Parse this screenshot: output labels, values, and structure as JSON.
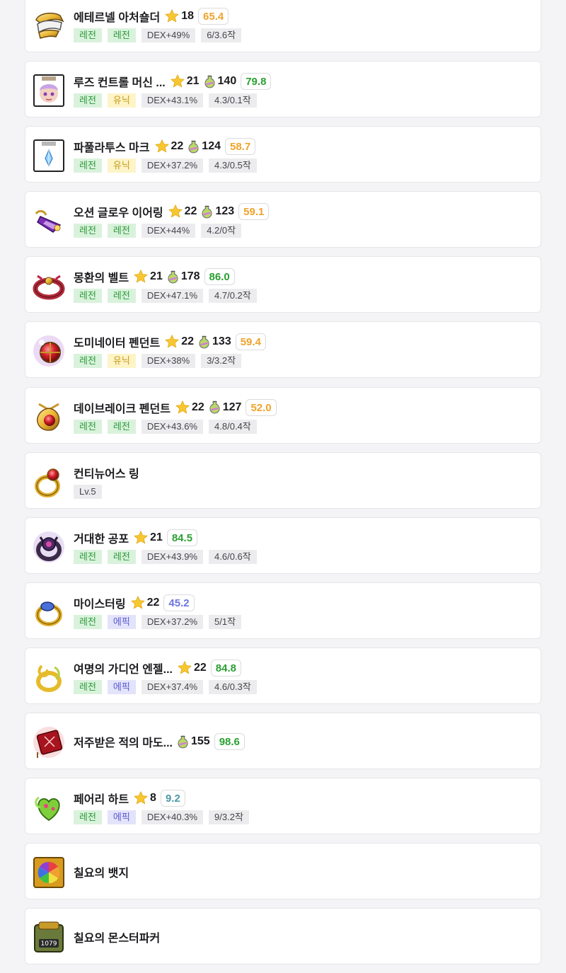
{
  "colors": {
    "score_green": "#2aa033",
    "score_orange": "#f0a32b",
    "score_blue": "#6c74e2",
    "score_teal": "#4b9aa8",
    "legendary_tag": "#d9f2dc",
    "unique_tag": "#fdf4c7",
    "epic_tag": "#e3e3fb"
  },
  "items": [
    {
      "name": "에테르넬 아처숄더",
      "icon": "archer-shoulder-icon",
      "stars": "18",
      "score": "65.4",
      "score_color": "#f0a32b",
      "tags": [
        {
          "text": "레전",
          "kind": "leg"
        },
        {
          "text": "레전",
          "kind": "leg"
        },
        {
          "text": "DEX+49%",
          "kind": "plain"
        },
        {
          "text": "6/3.6작",
          "kind": "plain"
        }
      ]
    },
    {
      "name": "루즈 컨트롤 머신 ...",
      "icon": "machine-card-icon",
      "stars": "21",
      "potential": "140",
      "score": "79.8",
      "score_color": "#2aa033",
      "tags": [
        {
          "text": "레전",
          "kind": "leg"
        },
        {
          "text": "유닉",
          "kind": "uni"
        },
        {
          "text": "DEX+43.1%",
          "kind": "plain"
        },
        {
          "text": "4.3/0.1작",
          "kind": "plain"
        }
      ]
    },
    {
      "name": "파풀라투스 마크",
      "icon": "papulatus-mark-icon",
      "stars": "22",
      "potential": "124",
      "score": "58.7",
      "score_color": "#f0a32b",
      "tags": [
        {
          "text": "레전",
          "kind": "leg"
        },
        {
          "text": "유닉",
          "kind": "uni"
        },
        {
          "text": "DEX+37.2%",
          "kind": "plain"
        },
        {
          "text": "4.3/0.5작",
          "kind": "plain"
        }
      ]
    },
    {
      "name": "오션 글로우 이어링",
      "icon": "earring-icon",
      "stars": "22",
      "potential": "123",
      "score": "59.1",
      "score_color": "#f0a32b",
      "tags": [
        {
          "text": "레전",
          "kind": "leg"
        },
        {
          "text": "레전",
          "kind": "leg"
        },
        {
          "text": "DEX+44%",
          "kind": "plain"
        },
        {
          "text": "4.2/0작",
          "kind": "plain"
        }
      ]
    },
    {
      "name": "몽환의 벨트",
      "icon": "belt-icon",
      "stars": "21",
      "potential": "178",
      "score": "86.0",
      "score_color": "#2aa033",
      "tags": [
        {
          "text": "레전",
          "kind": "leg"
        },
        {
          "text": "레전",
          "kind": "leg"
        },
        {
          "text": "DEX+47.1%",
          "kind": "plain"
        },
        {
          "text": "4.7/0.2작",
          "kind": "plain"
        }
      ]
    },
    {
      "name": "도미네이터 펜던트",
      "icon": "dominator-pendant-icon",
      "stars": "22",
      "potential": "133",
      "score": "59.4",
      "score_color": "#f0a32b",
      "tags": [
        {
          "text": "레전",
          "kind": "leg"
        },
        {
          "text": "유닉",
          "kind": "uni"
        },
        {
          "text": "DEX+38%",
          "kind": "plain"
        },
        {
          "text": "3/3.2작",
          "kind": "plain"
        }
      ]
    },
    {
      "name": "데이브레이크 펜던트",
      "icon": "daybreak-pendant-icon",
      "stars": "22",
      "potential": "127",
      "score": "52.0",
      "score_color": "#f0a32b",
      "tags": [
        {
          "text": "레전",
          "kind": "leg"
        },
        {
          "text": "레전",
          "kind": "leg"
        },
        {
          "text": "DEX+43.6%",
          "kind": "plain"
        },
        {
          "text": "4.8/0.4작",
          "kind": "plain"
        }
      ]
    },
    {
      "name": "컨티뉴어스 링",
      "icon": "continuous-ring-icon",
      "tags": [
        {
          "text": "Lv.5",
          "kind": "plain"
        }
      ]
    },
    {
      "name": "거대한 공포",
      "icon": "great-fear-ring-icon",
      "stars": "21",
      "score": "84.5",
      "score_color": "#2aa033",
      "tags": [
        {
          "text": "레전",
          "kind": "leg"
        },
        {
          "text": "레전",
          "kind": "leg"
        },
        {
          "text": "DEX+43.9%",
          "kind": "plain"
        },
        {
          "text": "4.6/0.6작",
          "kind": "plain"
        }
      ]
    },
    {
      "name": "마이스터링",
      "icon": "meister-ring-icon",
      "stars": "22",
      "score": "45.2",
      "score_color": "#6c74e2",
      "tags": [
        {
          "text": "레전",
          "kind": "leg"
        },
        {
          "text": "에픽",
          "kind": "epi"
        },
        {
          "text": "DEX+37.2%",
          "kind": "plain"
        },
        {
          "text": "5/1작",
          "kind": "plain"
        }
      ]
    },
    {
      "name": "여명의 가디언 엔젤...",
      "icon": "guardian-angel-ring-icon",
      "stars": "22",
      "score": "84.8",
      "score_color": "#2aa033",
      "tags": [
        {
          "text": "레전",
          "kind": "leg"
        },
        {
          "text": "에픽",
          "kind": "epi"
        },
        {
          "text": "DEX+37.4%",
          "kind": "plain"
        },
        {
          "text": "4.6/0.3작",
          "kind": "plain"
        }
      ]
    },
    {
      "name": "저주받은 적의 마도...",
      "icon": "cursed-magic-book-icon",
      "potential": "155",
      "score": "98.6",
      "score_color": "#2aa033",
      "tags": []
    },
    {
      "name": "페어리 하트",
      "icon": "fairy-heart-icon",
      "stars": "8",
      "score": "9.2",
      "score_color": "#4b9aa8",
      "tags": [
        {
          "text": "레전",
          "kind": "leg"
        },
        {
          "text": "에픽",
          "kind": "epi"
        },
        {
          "text": "DEX+40.3%",
          "kind": "plain"
        },
        {
          "text": "9/3.2작",
          "kind": "plain"
        }
      ]
    },
    {
      "name": "칠요의 뱃지",
      "icon": "seven-days-badge-icon",
      "tags": []
    },
    {
      "name": "칠요의 몬스터파커",
      "icon": "monster-parker-icon",
      "tags": []
    }
  ]
}
